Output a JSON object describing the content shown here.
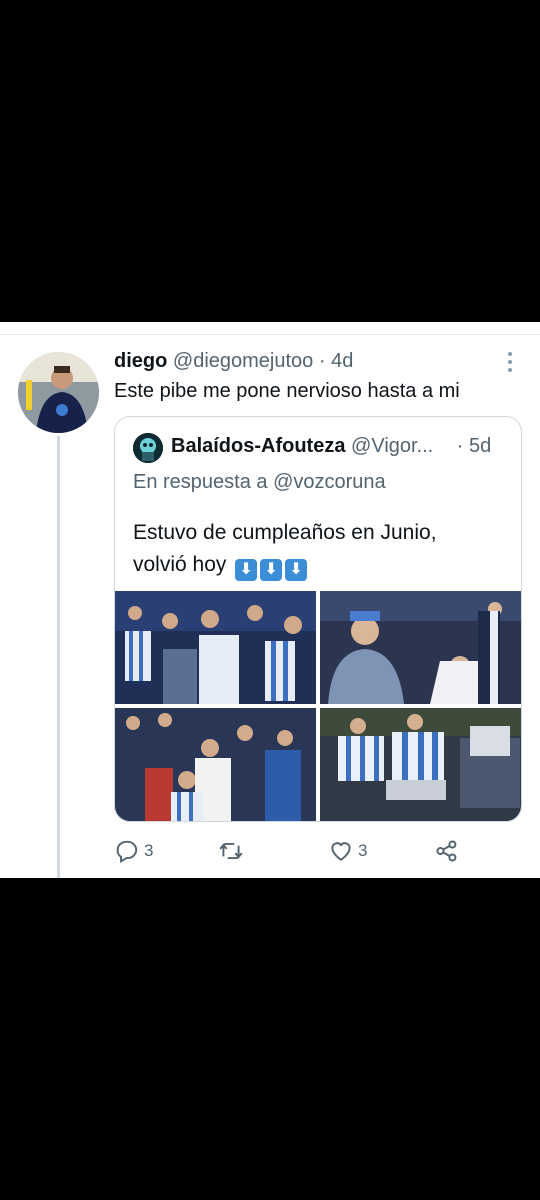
{
  "tweet": {
    "author_name": "diego",
    "author_handle": "@diegomejutoo",
    "separator": "·",
    "time": "4d",
    "text": "Este pibe me pone nervioso hasta a mi"
  },
  "quoted": {
    "author_name": "Balaídos-Afouteza",
    "author_handle": "@Vigor...",
    "separator": "·",
    "time": "5d",
    "reply_to": "En respuesta a @vozcoruna",
    "text_line1": "Estuvo de cumpleaños en Junio,",
    "text_line2": "volvió hoy",
    "emojis": [
      "⬇",
      "⬇",
      "⬇"
    ]
  },
  "actions": {
    "reply_count": "3",
    "retweet_count": "",
    "like_count": "3"
  },
  "icons": [
    "more-icon",
    "reply-icon",
    "retweet-icon",
    "like-icon",
    "share-icon"
  ],
  "colors": {
    "muted": "#536471",
    "border": "#cfd9de",
    "emoji_bg": "#3b8ed6"
  }
}
